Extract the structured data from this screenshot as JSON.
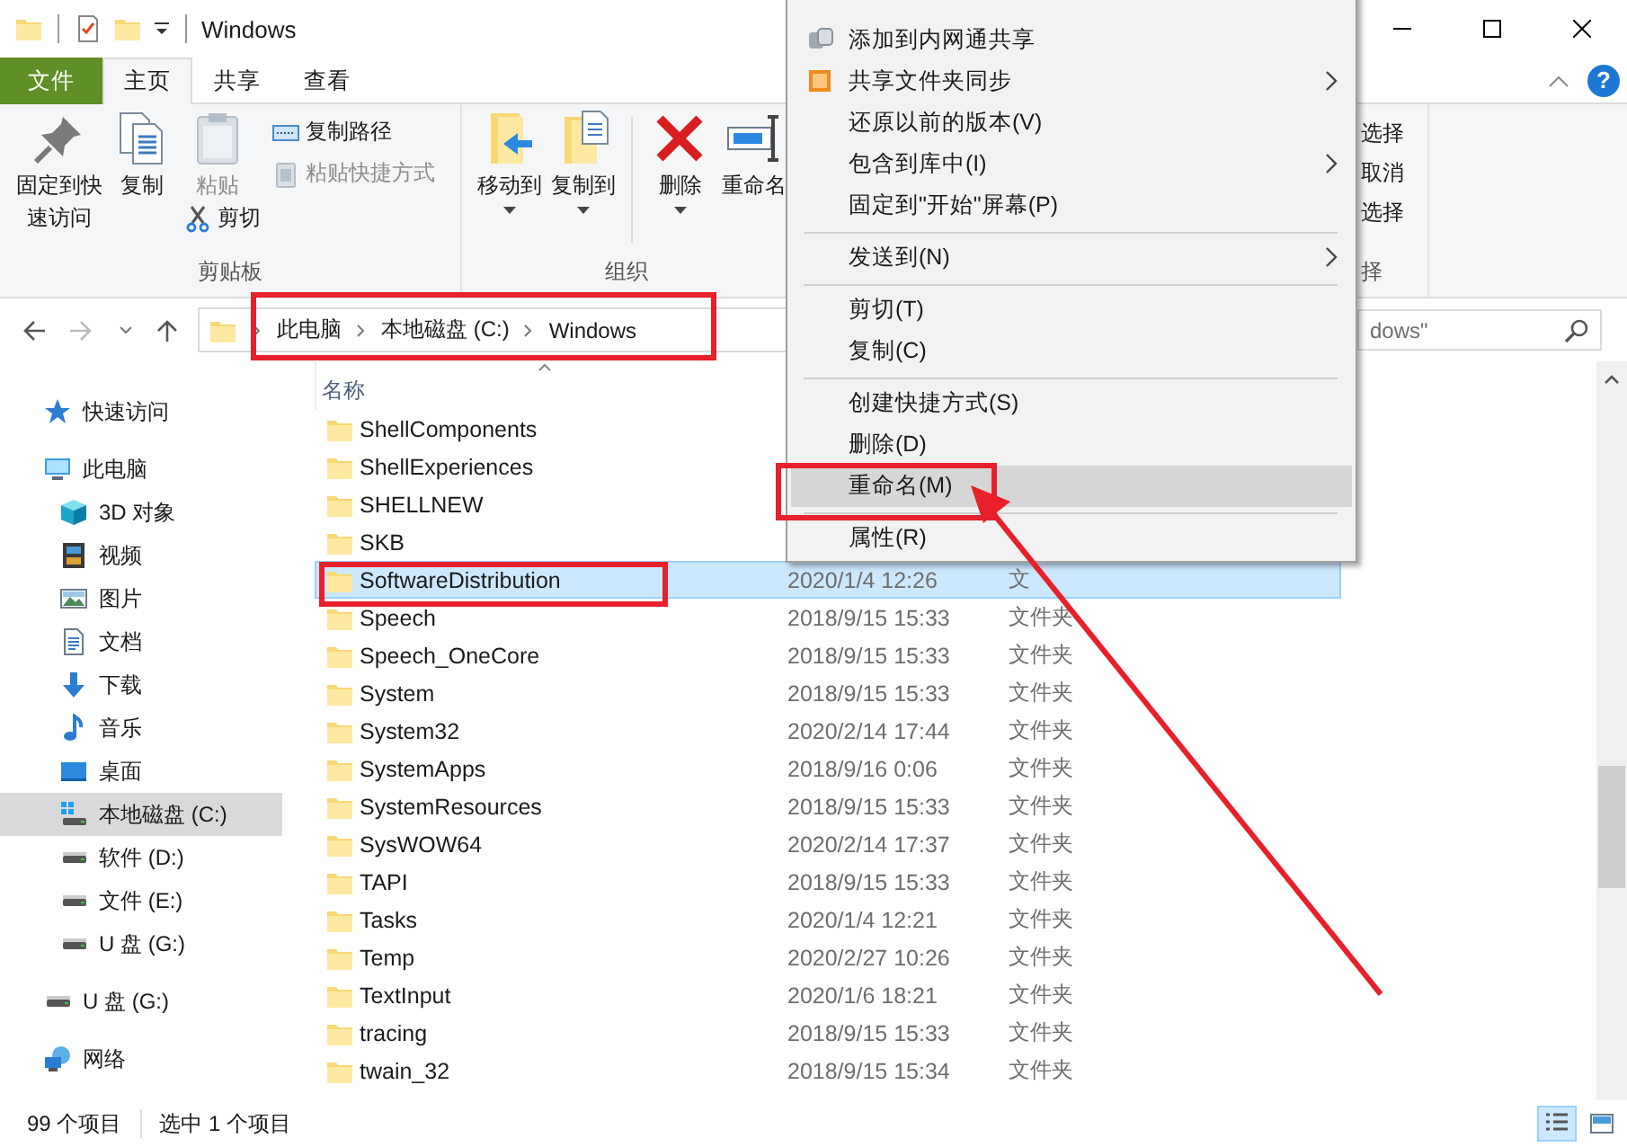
{
  "window": {
    "title": "Windows"
  },
  "ribbon": {
    "tabs": [
      {
        "label": "文件",
        "kind": "file",
        "selected": false
      },
      {
        "label": "主页",
        "kind": "tab",
        "selected": true
      },
      {
        "label": "共享",
        "kind": "tab",
        "selected": false
      },
      {
        "label": "查看",
        "kind": "tab",
        "selected": false
      }
    ],
    "help": "?",
    "groups": [
      {
        "label": "剪贴板",
        "commands": [
          {
            "label": "固定到快速访问",
            "kind": "pin",
            "disabled": false
          },
          {
            "label": "复制",
            "kind": "copy",
            "disabled": false
          },
          {
            "label": "粘贴",
            "kind": "paste",
            "disabled": true
          },
          {
            "label": "剪切",
            "kind": "cut",
            "disabled": false
          },
          {
            "label": "复制路径",
            "kind": "copy-path",
            "disabled": false
          },
          {
            "label": "粘贴快捷方式",
            "kind": "paste-shortcut",
            "disabled": true
          }
        ]
      },
      {
        "label": "组织",
        "commands": [
          {
            "label": "移动到",
            "kind": "move",
            "dropdown": true
          },
          {
            "label": "复制到",
            "kind": "copy-to",
            "dropdown": true
          },
          {
            "label": "删除",
            "kind": "delete",
            "dropdown": true
          },
          {
            "label": "重命名",
            "kind": "rename",
            "dropdown": false
          }
        ]
      },
      {
        "label": "择",
        "commands": [
          {
            "label": "选择"
          },
          {
            "label": "取消"
          },
          {
            "label": "选择"
          }
        ]
      }
    ]
  },
  "address": {
    "crumbs": [
      "此电脑",
      "本地磁盘 (C:)",
      "Windows"
    ]
  },
  "search": {
    "placeholder": "dows\""
  },
  "sidebar": {
    "items": [
      {
        "label": "快速访问",
        "kind": "star",
        "selected": false
      },
      {
        "label": "此电脑",
        "kind": "pc",
        "selected": false,
        "children": [
          {
            "label": "3D 对象",
            "kind": "cube",
            "selected": false
          },
          {
            "label": "视频",
            "kind": "video",
            "selected": false
          },
          {
            "label": "图片",
            "kind": "pictures",
            "selected": false
          },
          {
            "label": "文档",
            "kind": "documents",
            "selected": false
          },
          {
            "label": "下载",
            "kind": "downloads",
            "selected": false
          },
          {
            "label": "音乐",
            "kind": "music",
            "selected": false
          },
          {
            "label": "桌面",
            "kind": "desktop",
            "selected": false
          },
          {
            "label": "本地磁盘 (C:)",
            "kind": "drive-c",
            "selected": true
          },
          {
            "label": "软件 (D:)",
            "kind": "drive",
            "selected": false
          },
          {
            "label": "文件 (E:)",
            "kind": "drive",
            "selected": false
          },
          {
            "label": "U 盘 (G:)",
            "kind": "drive",
            "selected": false
          }
        ]
      },
      {
        "label": "U 盘 (G:)",
        "kind": "drive",
        "selected": false
      },
      {
        "label": "网络",
        "kind": "network",
        "selected": false
      }
    ]
  },
  "table": {
    "columns": [
      "名称"
    ],
    "rows": [
      {
        "name": "ShellComponents",
        "selected": false
      },
      {
        "name": "ShellExperiences",
        "selected": false
      },
      {
        "name": "SHELLNEW",
        "selected": false
      },
      {
        "name": "SKB",
        "selected": false
      },
      {
        "name": "SoftwareDistribution",
        "date": "2020/1/4 12:26",
        "type": "文",
        "selected": true
      },
      {
        "name": "Speech",
        "date": "2018/9/15 15:33",
        "type": "文件夹",
        "selected": false
      },
      {
        "name": "Speech_OneCore",
        "date": "2018/9/15 15:33",
        "type": "文件夹",
        "selected": false
      },
      {
        "name": "System",
        "date": "2018/9/15 15:33",
        "type": "文件夹",
        "selected": false
      },
      {
        "name": "System32",
        "date": "2020/2/14 17:44",
        "type": "文件夹",
        "selected": false
      },
      {
        "name": "SystemApps",
        "date": "2018/9/16 0:06",
        "type": "文件夹",
        "selected": false
      },
      {
        "name": "SystemResources",
        "date": "2018/9/15 15:33",
        "type": "文件夹",
        "selected": false
      },
      {
        "name": "SysWOW64",
        "date": "2020/2/14 17:37",
        "type": "文件夹",
        "selected": false
      },
      {
        "name": "TAPI",
        "date": "2018/9/15 15:33",
        "type": "文件夹",
        "selected": false
      },
      {
        "name": "Tasks",
        "date": "2020/1/4 12:21",
        "type": "文件夹",
        "selected": false
      },
      {
        "name": "Temp",
        "date": "2020/2/27 10:26",
        "type": "文件夹",
        "selected": false
      },
      {
        "name": "TextInput",
        "date": "2020/1/6 18:21",
        "type": "文件夹",
        "selected": false
      },
      {
        "name": "tracing",
        "date": "2018/9/15 15:33",
        "type": "文件夹",
        "selected": false
      },
      {
        "name": "twain_32",
        "date": "2018/9/15 15:34",
        "type": "文件夹",
        "selected": false
      }
    ]
  },
  "context_menu": {
    "items": [
      {
        "label": "添加到内网通共享",
        "kind": "lan",
        "submenu": false,
        "selected": false
      },
      {
        "label": "共享文件夹同步",
        "kind": "sync",
        "submenu": true,
        "selected": false
      },
      {
        "label": "还原以前的版本(V)",
        "kind": "plain",
        "submenu": false,
        "selected": false
      },
      {
        "label": "包含到库中(I)",
        "kind": "plain",
        "submenu": true,
        "selected": false
      },
      {
        "label": "固定到\"开始\"屏幕(P)",
        "kind": "plain",
        "submenu": false,
        "selected": false
      },
      {
        "kind": "separator"
      },
      {
        "label": "发送到(N)",
        "kind": "plain",
        "submenu": true,
        "selected": false
      },
      {
        "kind": "separator"
      },
      {
        "label": "剪切(T)",
        "kind": "plain",
        "submenu": false,
        "selected": false
      },
      {
        "label": "复制(C)",
        "kind": "plain",
        "submenu": false,
        "selected": false
      },
      {
        "kind": "separator"
      },
      {
        "label": "创建快捷方式(S)",
        "kind": "plain",
        "submenu": false,
        "selected": false
      },
      {
        "label": "删除(D)",
        "kind": "plain",
        "submenu": false,
        "selected": false
      },
      {
        "label": "重命名(M)",
        "kind": "plain",
        "submenu": false,
        "selected": true
      },
      {
        "kind": "separator"
      },
      {
        "label": "属性(R)",
        "kind": "plain",
        "submenu": false,
        "selected": false
      }
    ]
  },
  "status_bar": {
    "count": "99 个项目",
    "selection": "选中 1 个项目",
    "views": [
      {
        "kind": "details",
        "selected": true
      },
      {
        "kind": "large-icons",
        "selected": false
      }
    ]
  }
}
